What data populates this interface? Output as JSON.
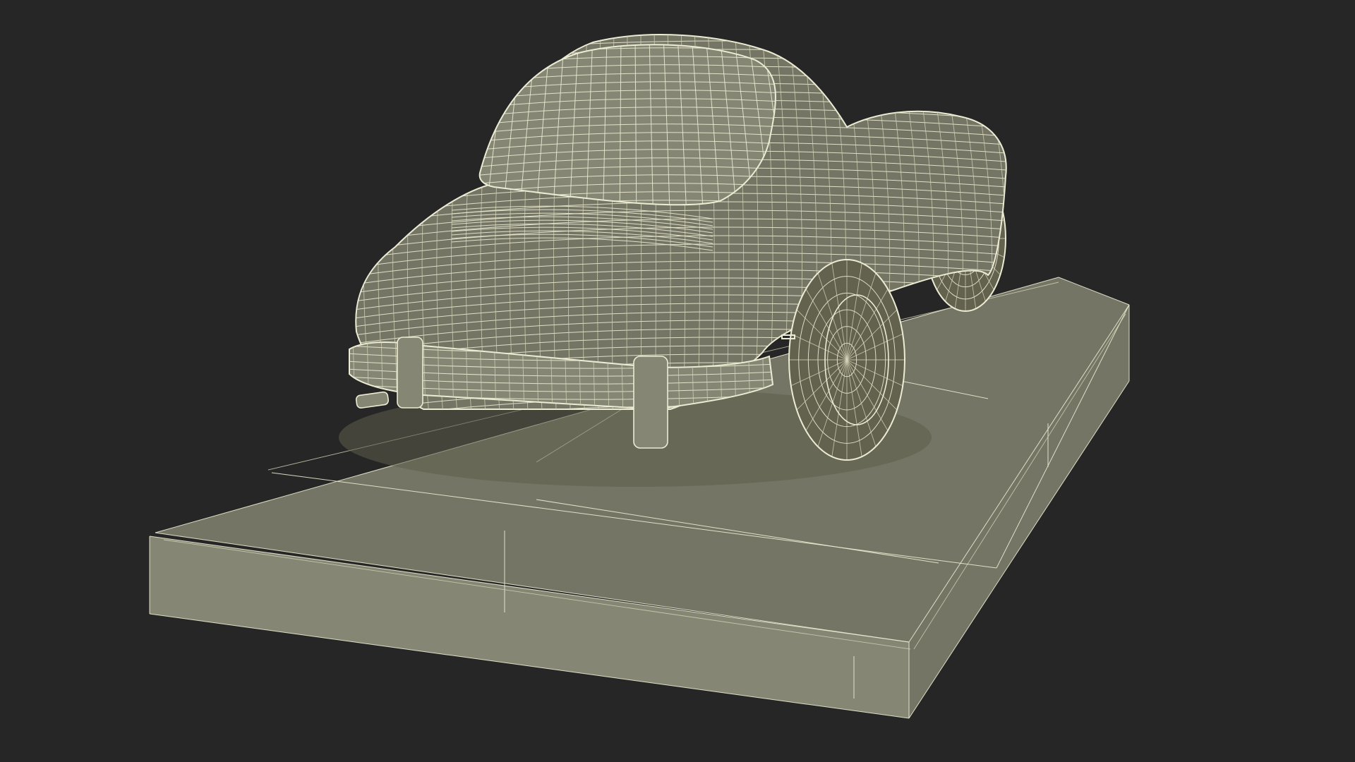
{
  "scene": {
    "subject": "wireframe-car-on-display-pedestal",
    "colors": {
      "background": "#262626",
      "surface": "#757565",
      "surface_light": "#868675",
      "surface_dark": "#62624f",
      "wire": "#ecebd3",
      "wire_dim": "#d6d4b6"
    }
  }
}
